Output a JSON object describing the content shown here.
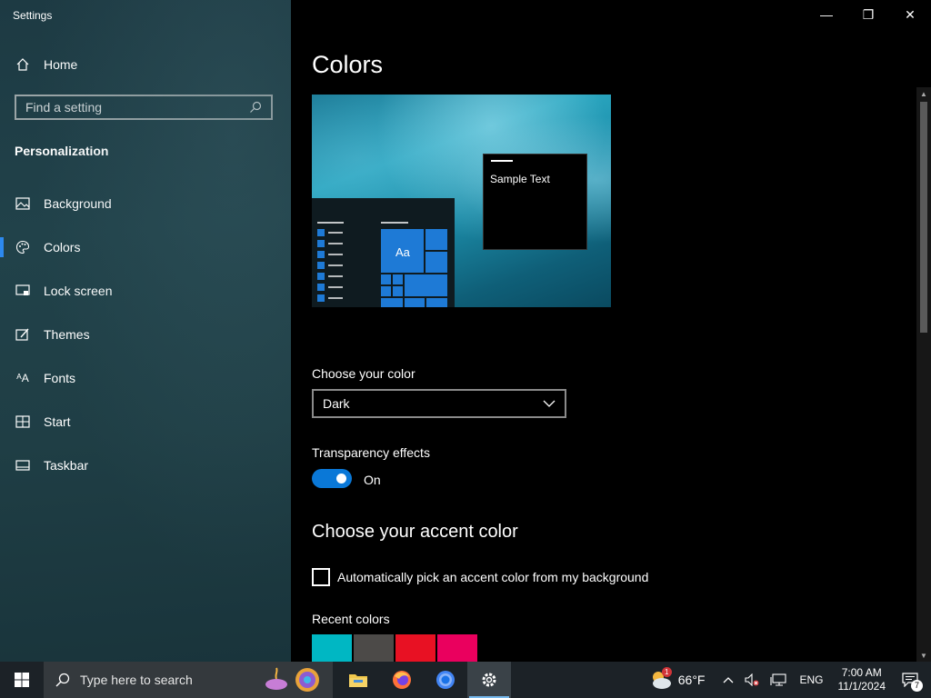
{
  "window": {
    "app_title": "Settings",
    "controls": {
      "minimize": "—",
      "restore": "❐",
      "close": "✕"
    }
  },
  "sidebar": {
    "home_label": "Home",
    "search_placeholder": "Find a setting",
    "section_title": "Personalization",
    "items": [
      {
        "label": "Background",
        "icon": "picture-icon"
      },
      {
        "label": "Colors",
        "icon": "palette-icon",
        "active": true
      },
      {
        "label": "Lock screen",
        "icon": "lock-screen-icon"
      },
      {
        "label": "Themes",
        "icon": "themes-icon"
      },
      {
        "label": "Fonts",
        "icon": "fonts-icon"
      },
      {
        "label": "Start",
        "icon": "start-icon"
      },
      {
        "label": "Taskbar",
        "icon": "taskbar-icon"
      }
    ]
  },
  "main": {
    "title": "Colors",
    "preview": {
      "tile_text": "Aa",
      "sample_text": "Sample Text"
    },
    "choose_color": {
      "label": "Choose your color",
      "value": "Dark"
    },
    "transparency": {
      "label": "Transparency effects",
      "state": "On",
      "enabled": true
    },
    "accent": {
      "heading": "Choose your accent color",
      "auto_label": "Automatically pick an accent color from my background",
      "auto_checked": false,
      "recent_label": "Recent colors",
      "recent_colors": [
        "#00b7c3",
        "#4c4a48",
        "#e81123",
        "#ea005e"
      ]
    }
  },
  "taskbar": {
    "search_placeholder": "Type here to search",
    "apps": [
      "file-explorer-icon",
      "firefox-icon",
      "chrome-icon",
      "settings-icon"
    ],
    "weather": {
      "temp": "66°F",
      "badge": "1"
    },
    "language": "ENG",
    "time": "7:00 AM",
    "date": "11/1/2024",
    "notifications": "7"
  },
  "colors": {
    "accent": "#0a78d7",
    "sidebar_bg": "#1f3e45",
    "main_bg": "#000000",
    "taskbar_bg": "#1c2227"
  }
}
